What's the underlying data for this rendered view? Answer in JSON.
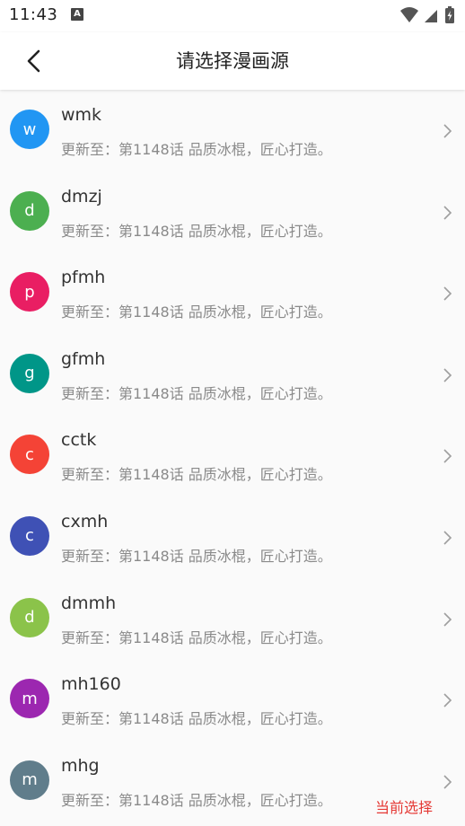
{
  "status_bar": {
    "time": "11:43",
    "notification_icon": "A",
    "icons": [
      "wifi-icon",
      "signal-icon",
      "battery-charging-icon"
    ]
  },
  "app_bar": {
    "back_icon": "chevron-left-icon",
    "title": "请选择漫画源"
  },
  "sources": [
    {
      "letter": "w",
      "name": "wmk",
      "subtitle": "更新至：第1148话 品质冰棍，匠心打造。",
      "color": "#2196f3",
      "current": ""
    },
    {
      "letter": "d",
      "name": "dmzj",
      "subtitle": "更新至：第1148话 品质冰棍，匠心打造。",
      "color": "#4caf50",
      "current": ""
    },
    {
      "letter": "p",
      "name": "pfmh",
      "subtitle": "更新至：第1148话 品质冰棍，匠心打造。",
      "color": "#e91e63",
      "current": ""
    },
    {
      "letter": "g",
      "name": "gfmh",
      "subtitle": "更新至：第1148话 品质冰棍，匠心打造。",
      "color": "#009688",
      "current": ""
    },
    {
      "letter": "c",
      "name": "cctk",
      "subtitle": "更新至：第1148话 品质冰棍，匠心打造。",
      "color": "#f44336",
      "current": ""
    },
    {
      "letter": "c",
      "name": "cxmh",
      "subtitle": "更新至：第1148话 品质冰棍，匠心打造。",
      "color": "#3f51b5",
      "current": ""
    },
    {
      "letter": "d",
      "name": "dmmh",
      "subtitle": "更新至：第1148话 品质冰棍，匠心打造。",
      "color": "#8bc34a",
      "current": ""
    },
    {
      "letter": "m",
      "name": "mh160",
      "subtitle": "更新至：第1148话 品质冰棍，匠心打造。",
      "color": "#9c27b0",
      "current": ""
    },
    {
      "letter": "m",
      "name": "mhg",
      "subtitle": "更新至：第1148话 品质冰棍，匠心打造。",
      "color": "#607d8b",
      "current": "当前选择"
    }
  ]
}
